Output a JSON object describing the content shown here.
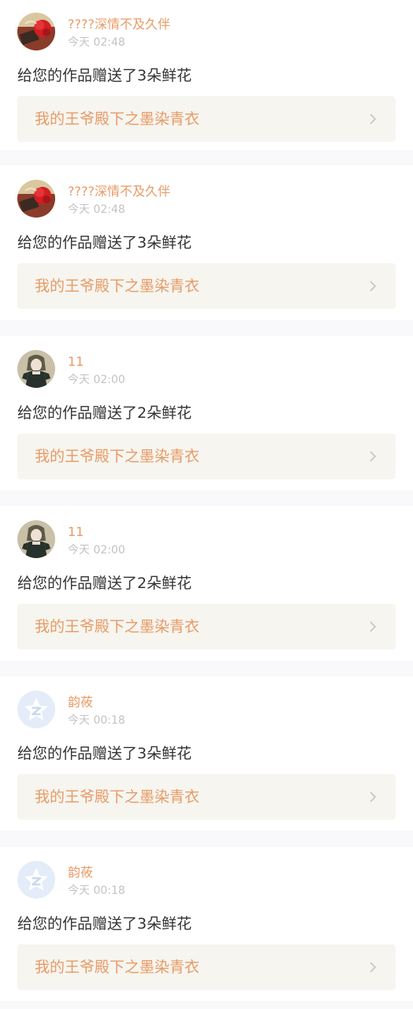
{
  "colors": {
    "accent": "#e89a66",
    "message_text": "#333333",
    "time_text": "#c3c3c3",
    "link_background": "#f6f5ef",
    "page_background": "#f9f9fb"
  },
  "notifications": [
    {
      "avatar": "red-flower-avatar",
      "username": "????深情不及久伴",
      "time": "今天 02:48",
      "message": "给您的作品赠送了3朵鲜花",
      "work_title": "我的王爷殿下之墨染青衣",
      "chevron_icon": "chevron-right-icon"
    },
    {
      "avatar": "red-flower-avatar",
      "username": "????深情不及久伴",
      "time": "今天 02:48",
      "message": "给您的作品赠送了3朵鲜花",
      "work_title": "我的王爷殿下之墨染青衣",
      "chevron_icon": "chevron-right-icon"
    },
    {
      "avatar": "anime-girl-avatar",
      "username": "11",
      "time": "今天 02:00",
      "message": "给您的作品赠送了2朵鲜花",
      "work_title": "我的王爷殿下之墨染青衣",
      "chevron_icon": "chevron-right-icon"
    },
    {
      "avatar": "anime-girl-avatar",
      "username": "11",
      "time": "今天 02:00",
      "message": "给您的作品赠送了2朵鲜花",
      "work_title": "我的王爷殿下之墨染青衣",
      "chevron_icon": "chevron-right-icon"
    },
    {
      "avatar": "qq-zone-star-avatar",
      "username": "韵莜",
      "time": "今天 00:18",
      "message": "给您的作品赠送了3朵鲜花",
      "work_title": "我的王爷殿下之墨染青衣",
      "chevron_icon": "chevron-right-icon"
    },
    {
      "avatar": "qq-zone-star-avatar",
      "username": "韵莜",
      "time": "今天 00:18",
      "message": "给您的作品赠送了3朵鲜花",
      "work_title": "我的王爷殿下之墨染青衣",
      "chevron_icon": "chevron-right-icon"
    }
  ]
}
